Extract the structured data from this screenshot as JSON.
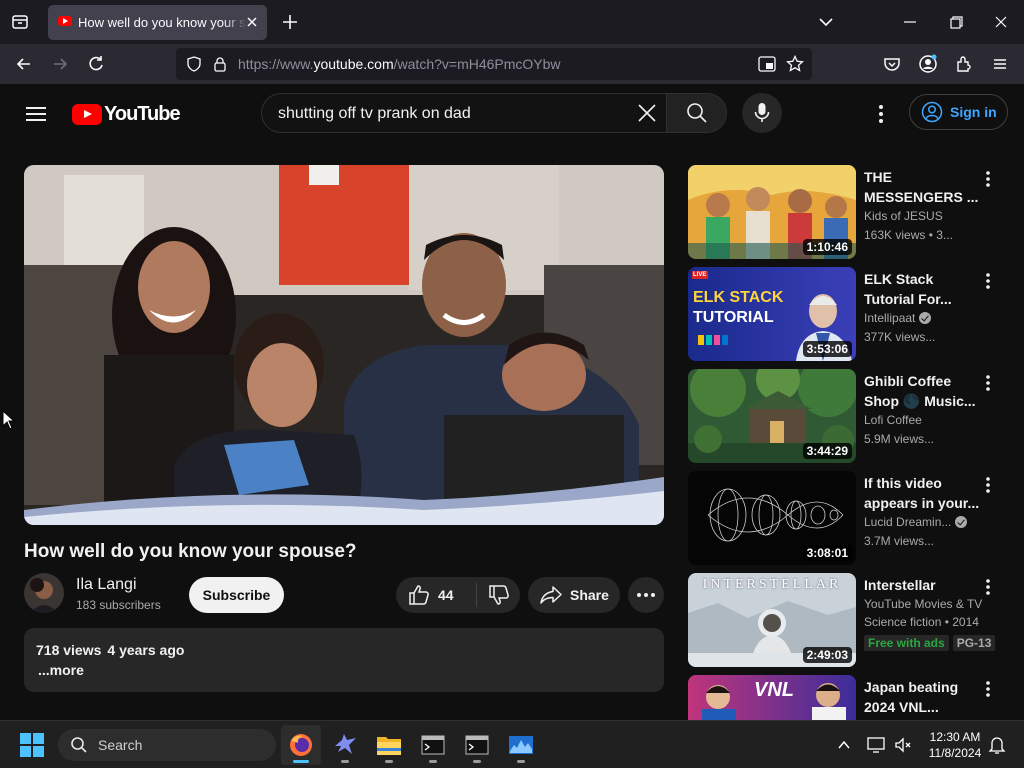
{
  "browser": {
    "tab_title": "How well do you know your spouse? - YouTube",
    "url_prefix": "https://www.",
    "url_domain": "youtube.com",
    "url_path": "/watch?v=mH46PmcOYbw"
  },
  "yt": {
    "logo_text": "YouTube",
    "search_query": "shutting off tv prank on dad",
    "sign_in": "Sign in",
    "accent": "#ff0000",
    "link_blue": "#3ea6ff"
  },
  "video": {
    "title": "How well do you know your spouse?",
    "channel": "Ila Langi",
    "subscribers": "183 subscribers",
    "subscribe_label": "Subscribe",
    "likes": "44",
    "share_label": "Share",
    "views": "718 views",
    "age": "4 years ago",
    "more": "...more"
  },
  "related": [
    {
      "title": "THE MESSENGERS ...",
      "channel": "Kids of JESUS",
      "meta": "163K views • 3...",
      "duration": "1:10:46",
      "verified": false
    },
    {
      "title": "ELK Stack Tutorial For...",
      "channel": "Intellipaat",
      "meta": "377K views...",
      "duration": "3:53:06",
      "verified": true,
      "thumb_text_1": "ELK STACK",
      "thumb_text_2": "TUTORIAL",
      "live_tag": "LIVE"
    },
    {
      "title": "Ghibli Coffee Shop 🌑 Music...",
      "channel": "Lofi Coffee",
      "meta": "5.9M views...",
      "duration": "3:44:29",
      "verified": false
    },
    {
      "title": "If this video appears in your...",
      "channel": "Lucid Dreamin...",
      "meta": "3.7M views...",
      "duration": "3:08:01",
      "verified": true
    },
    {
      "title": "Interstellar",
      "channel": "YouTube Movies & TV",
      "meta": "Science fiction • 2014",
      "duration": "2:49:03",
      "verified": false,
      "badge_1": "Free with ads",
      "badge_2": "PG-13",
      "thumb_text_1": "INTERSTELLAR"
    },
    {
      "title": "Japan beating 2024 VNL...",
      "channel": "",
      "meta": "",
      "duration": "",
      "verified": false,
      "thumb_text_1": "VNL"
    }
  ],
  "taskbar": {
    "search_label": "Search",
    "time": "12:30 AM",
    "date": "11/8/2024"
  }
}
